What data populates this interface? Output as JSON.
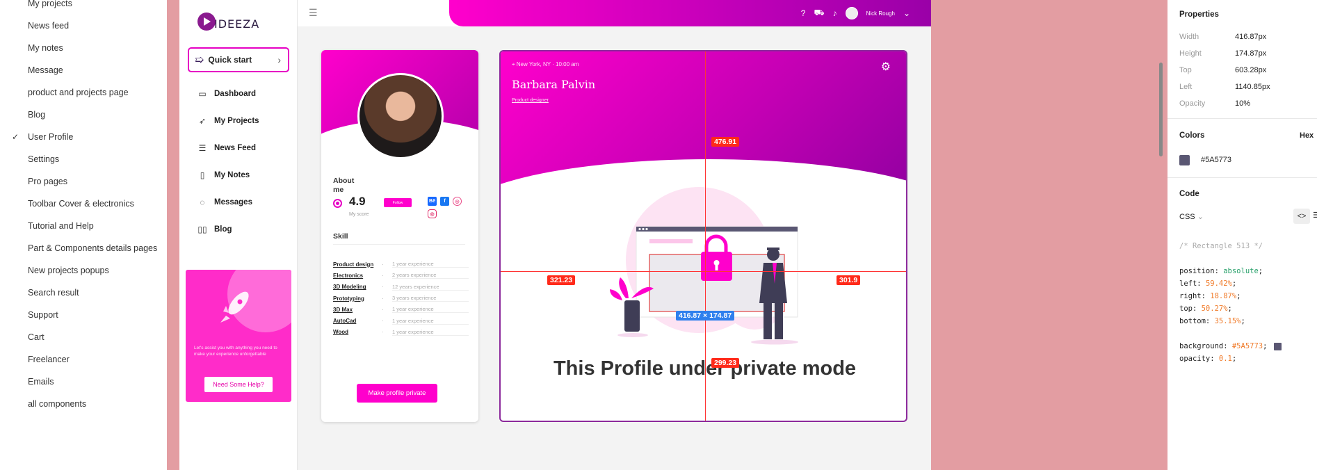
{
  "pages": {
    "items": [
      {
        "label": "My projects"
      },
      {
        "label": "News feed"
      },
      {
        "label": "My notes"
      },
      {
        "label": "Message"
      },
      {
        "label": "product and projects page"
      },
      {
        "label": "Blog"
      },
      {
        "label": "User Profile",
        "selected": true
      },
      {
        "label": "Settings"
      },
      {
        "label": "Pro pages"
      },
      {
        "label": "Toolbar Cover & electronics"
      },
      {
        "label": "Tutorial and Help"
      },
      {
        "label": "Part & Components details pages"
      },
      {
        "label": "New projects popups"
      },
      {
        "label": "Search result"
      },
      {
        "label": "Support"
      },
      {
        "label": "Cart"
      },
      {
        "label": "Freelancer"
      },
      {
        "label": "Emails"
      },
      {
        "label": "all components"
      }
    ]
  },
  "app": {
    "logo": "IDEEZA",
    "quick_start": "Quick start",
    "nav": [
      {
        "label": "Dashboard",
        "icon": "briefcase-icon"
      },
      {
        "label": "My Projects",
        "icon": "rocket-icon"
      },
      {
        "label": "News Feed",
        "icon": "list-icon"
      },
      {
        "label": "My Notes",
        "icon": "document-icon"
      },
      {
        "label": "Messages",
        "icon": "chat-icon"
      },
      {
        "label": "Blog",
        "icon": "book-icon"
      }
    ],
    "help_card": {
      "text": "Let's assist you with anything you need to make your experience unforgettable",
      "button": "Need Some Help?"
    },
    "topbar": {
      "user_name": "Nick Rough"
    }
  },
  "profile_card": {
    "about_title": "About me",
    "score": "4.9",
    "score_label": "My score",
    "follow": "Follow",
    "skill_title": "Skill",
    "skills": [
      {
        "name": "Product design",
        "exp": "1 year experience"
      },
      {
        "name": "Electronics",
        "exp": "2 years experience"
      },
      {
        "name": "3D Modeling",
        "exp": "12 years experience"
      },
      {
        "name": "Prototyping",
        "exp": "3 years experience"
      },
      {
        "name": "3D Max",
        "exp": "1 year experience"
      },
      {
        "name": "AutoCad",
        "exp": "1 year experience"
      },
      {
        "name": "Wood",
        "exp": "1 year experience"
      }
    ],
    "private_button": "Make profile private"
  },
  "main_card": {
    "location": "New York, NY · 10:00 am",
    "name": "Barbara Palvin",
    "role": "Product designer",
    "message": "This Profile under private mode"
  },
  "measurements": {
    "top": "476.91",
    "left": "321.23",
    "right": "301.9",
    "bottom": "299.23",
    "size": "416.87 × 174.87"
  },
  "properties": {
    "section_title": "Properties",
    "rows": [
      {
        "key": "Width",
        "value": "416.87px"
      },
      {
        "key": "Height",
        "value": "174.87px"
      },
      {
        "key": "Top",
        "value": "603.28px"
      },
      {
        "key": "Left",
        "value": "1140.85px"
      },
      {
        "key": "Opacity",
        "value": "10%"
      }
    ],
    "colors_title": "Colors",
    "hex_label": "Hex",
    "color_value": "#5A5773",
    "code_title": "Code",
    "code_lang": "CSS",
    "code": {
      "comment": "/* Rectangle 513 */",
      "position_key": "position: ",
      "position_val": "absolute",
      "left_key": "left: ",
      "left_val": "59.42%",
      "right_key": "right: ",
      "right_val": "18.87%",
      "top_key": "top: ",
      "top_val": "50.27%",
      "bottom_key": "bottom: ",
      "bottom_val": "35.15%",
      "bg_key": "background: ",
      "bg_val": "#5A5773",
      "opacity_key": "opacity: ",
      "opacity_val": "0.1"
    }
  },
  "colors": {
    "accent": "#ff00cc",
    "canvas_bg": "#e39da2",
    "selection": "#8c2a9c",
    "measure": "#ff2a1a"
  }
}
